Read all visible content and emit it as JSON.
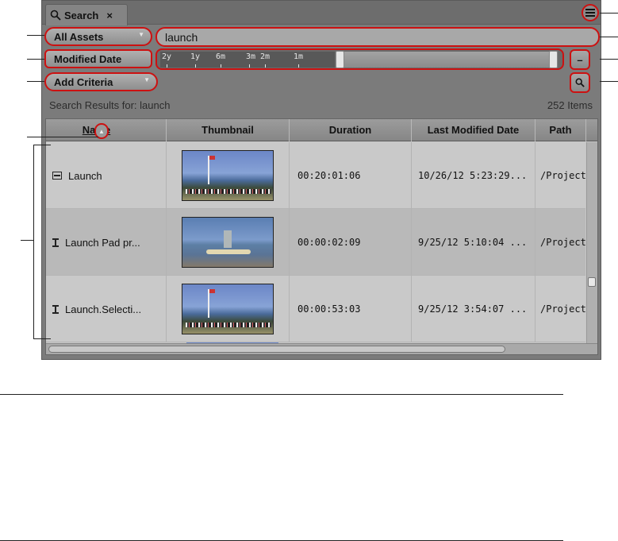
{
  "tab": {
    "label": "Search",
    "close": "×"
  },
  "toolbar": {
    "scope_label": "All Assets",
    "search_value": "launch",
    "criteria_label": "Modified Date",
    "add_criteria_label": "Add Criteria",
    "remove_label": "–"
  },
  "timeline": {
    "ticks": [
      "2y",
      "1y",
      "6m",
      "3m",
      "2m",
      "1m"
    ]
  },
  "results": {
    "label": "Search Results for: launch",
    "count": "252 Items"
  },
  "table": {
    "columns": [
      "Name",
      "Thumbnail",
      "Duration",
      "Last Modified Date",
      "Path"
    ],
    "rows": [
      {
        "icon": "clip-icon",
        "name": "Launch",
        "duration": "00:20:01:06",
        "modified": "10/26/12 5:23:29...",
        "path": "/Project"
      },
      {
        "icon": "sequence-icon",
        "name": "Launch Pad pr...",
        "duration": "00:00:02:09",
        "modified": "9/25/12 5:10:04 ...",
        "path": "/Project"
      },
      {
        "icon": "sequence-icon",
        "name": "Launch.Selecti...",
        "duration": "00:00:53:03",
        "modified": "9/25/12 3:54:07 ...",
        "path": "/Project"
      }
    ]
  },
  "colors": {
    "highlight": "#cc1111",
    "panel": "#7b7b7b",
    "table_bg": "#c6c6c6"
  }
}
